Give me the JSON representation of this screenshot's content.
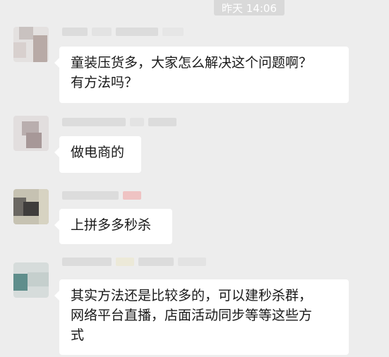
{
  "timestamp": "昨天 14:06",
  "messages": [
    {
      "lines": [
        "童装压货多，大家怎么解决这个问题啊？",
        "有方法吗？"
      ]
    },
    {
      "lines": [
        "做电商的"
      ]
    },
    {
      "lines": [
        "上拼多多秒杀"
      ]
    },
    {
      "lines": [
        "其实方法还是比较多的，可以建秒杀群，",
        "网络平台直播，店面活动同步等等这些方",
        "式"
      ]
    }
  ],
  "colors": {
    "background": "#ededed",
    "bubble": "#ffffff",
    "text": "#191919",
    "timestamp_bg": "#d9d9d9"
  }
}
